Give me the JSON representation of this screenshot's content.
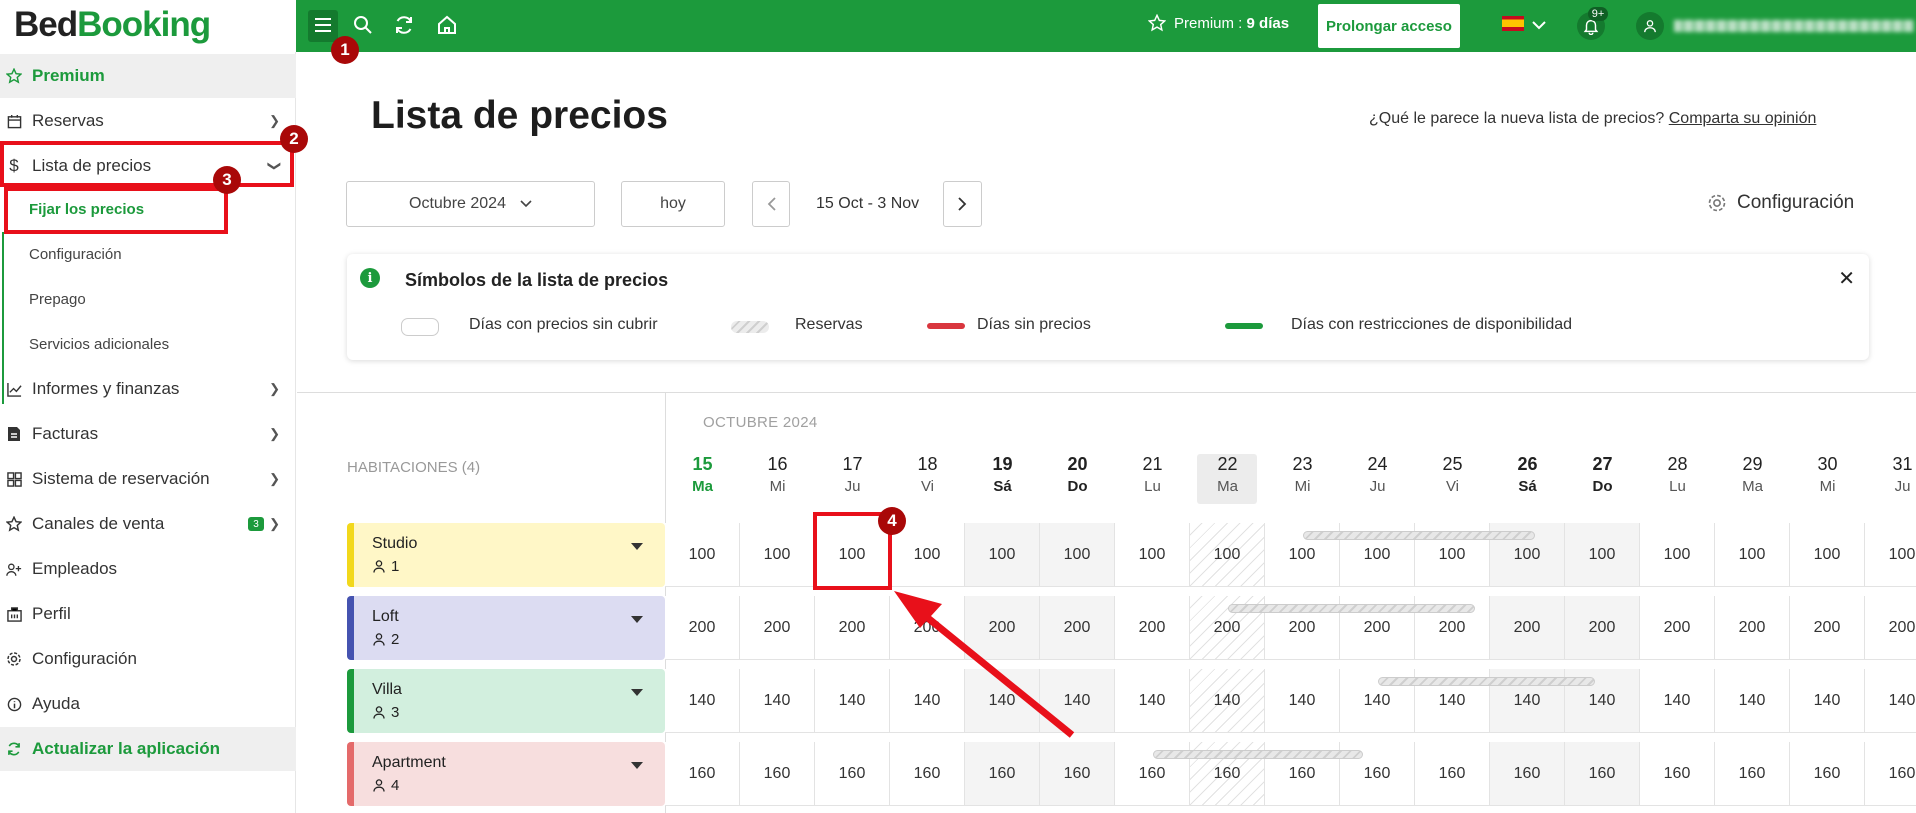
{
  "app": {
    "logo_part1": "Bed",
    "logo_part2": "Booking"
  },
  "topbar": {
    "premium_label": "Premium : ",
    "premium_days": "9 días",
    "prolong_label": "Prolongar acceso",
    "notifications_badge": "9+",
    "icons": [
      "menu-icon",
      "search-icon",
      "refresh-icon",
      "home-icon",
      "star-icon",
      "flag-es-icon",
      "bell-icon",
      "user-icon"
    ]
  },
  "sidebar": {
    "premium": "Premium",
    "reservas": "Reservas",
    "lista_precios": "Lista de precios",
    "sub": [
      "Fijar los precios",
      "Configuración",
      "Prepago",
      "Servicios adicionales"
    ],
    "informes": "Informes y finanzas",
    "facturas": "Facturas",
    "sistema": "Sistema de reservación",
    "canales": "Canales de venta",
    "canales_badge": "3",
    "empleados": "Empleados",
    "perfil": "Perfil",
    "configuracion": "Configuración",
    "ayuda": "Ayuda",
    "actualizar": "Actualizar la aplicación"
  },
  "main": {
    "title": "Lista de precios",
    "opinion_text": "¿Qué le parece la nueva lista de precios? ",
    "opinion_link": "Comparta su opinión",
    "month_select": "Octubre 2024",
    "today_button": "hoy",
    "date_range": "15 Oct - 3 Nov",
    "config_label": "Configuración"
  },
  "legend": {
    "title": "Símbolos de la lista de precios",
    "items": [
      "Días con precios sin cubrir",
      "Reservas",
      "Días sin precios",
      "Días con restricciones de disponibilidad"
    ],
    "colors": {
      "no_price": "#d9363e",
      "restriction": "#1c9a3c"
    }
  },
  "grid": {
    "rooms_header": "HABITACIONES (4)",
    "month_label": "OCTUBRE 2024",
    "days": [
      {
        "num": "15",
        "name": "Ma"
      },
      {
        "num": "16",
        "name": "Mi"
      },
      {
        "num": "17",
        "name": "Ju"
      },
      {
        "num": "18",
        "name": "Vi"
      },
      {
        "num": "19",
        "name": "Sá"
      },
      {
        "num": "20",
        "name": "Do"
      },
      {
        "num": "21",
        "name": "Lu"
      },
      {
        "num": "22",
        "name": "Ma"
      },
      {
        "num": "23",
        "name": "Mi"
      },
      {
        "num": "24",
        "name": "Ju"
      },
      {
        "num": "25",
        "name": "Vi"
      },
      {
        "num": "26",
        "name": "Sá"
      },
      {
        "num": "27",
        "name": "Do"
      },
      {
        "num": "28",
        "name": "Lu"
      },
      {
        "num": "29",
        "name": "Ma"
      },
      {
        "num": "30",
        "name": "Mi"
      },
      {
        "num": "31",
        "name": "Ju"
      }
    ],
    "rooms": [
      {
        "name": "Studio",
        "capacity": "1",
        "color": "#fff7c7",
        "strip": "#f2d81b",
        "price": "100"
      },
      {
        "name": "Loft",
        "capacity": "2",
        "color": "#dcdcf2",
        "strip": "#4553b0",
        "price": "200"
      },
      {
        "name": "Villa",
        "capacity": "3",
        "color": "#d2efde",
        "strip": "#1c9a3c",
        "price": "140"
      },
      {
        "name": "Apartment",
        "capacity": "4",
        "color": "#f7dede",
        "strip": "#e46a6a",
        "price": "160"
      }
    ]
  },
  "annotations": {
    "steps": [
      "1",
      "2",
      "3",
      "4"
    ]
  }
}
